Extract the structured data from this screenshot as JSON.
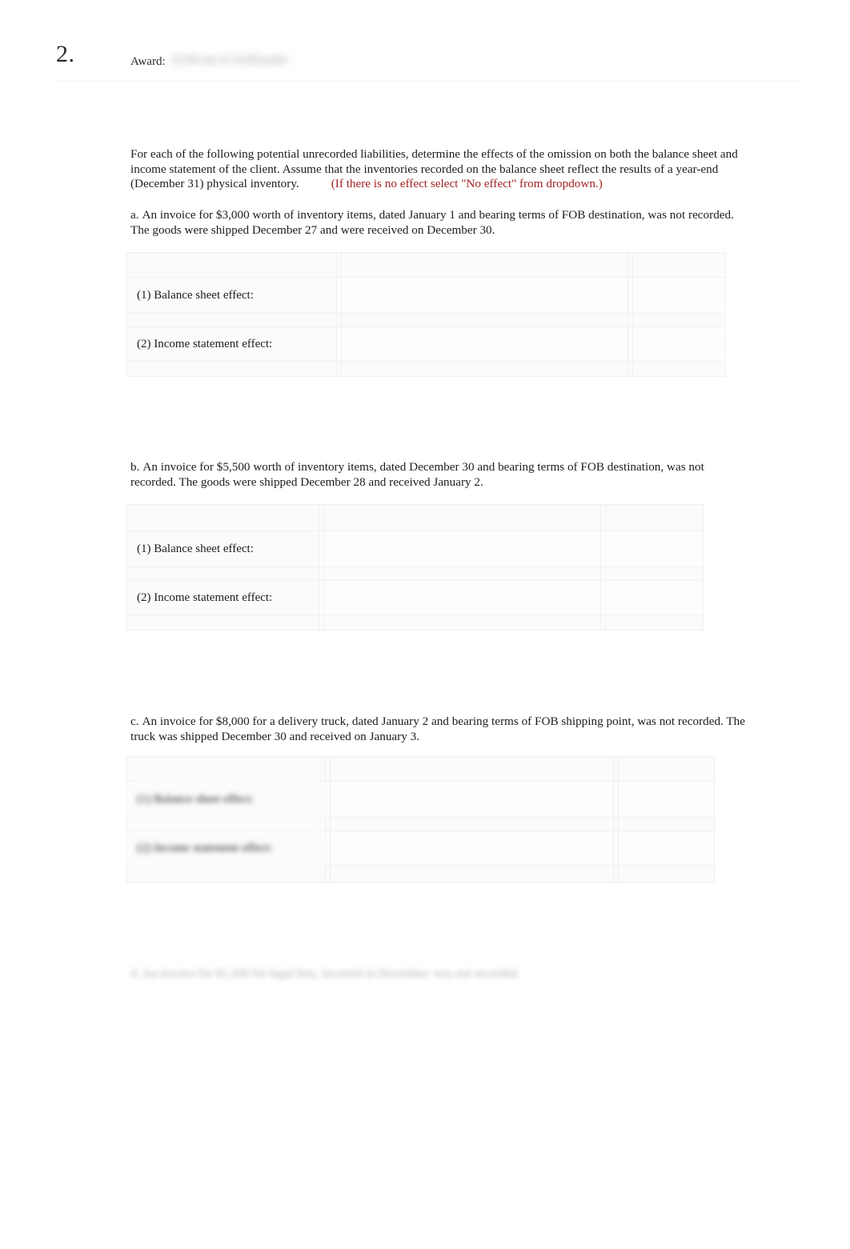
{
  "header": {
    "question_number": "2.",
    "award_label": "Award:",
    "award_value": "10.00 out of 10.00 points"
  },
  "intro": {
    "text": "For each of the following potential unrecorded liabilities, determine the effects of the omission on both the balance sheet and income statement of the client. Assume that the inventories recorded on the balance sheet reflect the results of a year-end (December 31) physical inventory.",
    "note": "(If there is no effect select \"No effect\" from dropdown.)"
  },
  "items": [
    {
      "marker": "a.",
      "text": "An invoice for $3,000 worth of inventory items, dated January 1 and bearing terms of FOB destination, was not recorded. The goods were shipped December 27 and were received on December 30.",
      "rows": [
        {
          "label": "(1) Balance sheet effect:",
          "answer": "",
          "amount": ""
        },
        {
          "label": "(2) Income statement effect:",
          "answer": "",
          "amount": ""
        }
      ]
    },
    {
      "marker": "b.",
      "text": "An invoice for $5,500 worth of inventory items, dated December 30 and bearing terms of FOB destination, was not recorded. The goods were shipped December 28 and received January 2.",
      "rows": [
        {
          "label": "(1) Balance sheet effect:",
          "answer": "",
          "amount": ""
        },
        {
          "label": "(2) Income statement effect:",
          "answer": "",
          "amount": ""
        }
      ]
    },
    {
      "marker": "c.",
      "text": "An invoice for $8,000 for a delivery truck, dated January 2 and bearing terms of FOB shipping point, was not recorded. The truck was shipped December 30 and received on January 3.",
      "rows": [
        {
          "label": "(1) Balance sheet effect:",
          "answer": "",
          "amount": ""
        },
        {
          "label": "(2) Income statement effect:",
          "answer": "",
          "amount": ""
        }
      ]
    }
  ],
  "trailing_item": {
    "text": "d. An invoice for $1,500 for legal fees, incurred in December, was not recorded."
  }
}
